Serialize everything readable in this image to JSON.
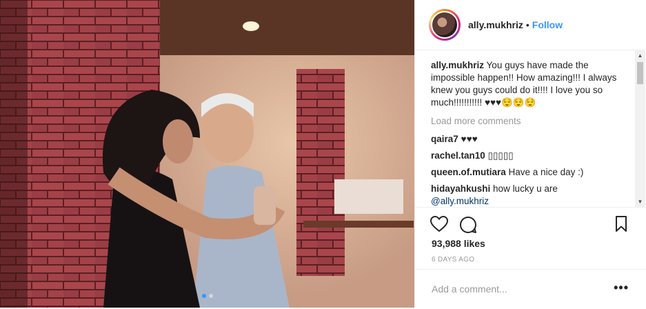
{
  "post": {
    "username": "ally.mukhriz",
    "separator": "•",
    "follow_label": "Follow",
    "caption_user": "ally.mukhriz",
    "caption_text": "You guys have made the impossible happen!! How amazing!!! I always knew you guys could do it!!!! I love you so much!!!!!!!!!!! ♥♥♥😌😌😌",
    "load_more": "Load more comments",
    "comments": [
      {
        "user": "qaira7",
        "text": "♥♥♥"
      },
      {
        "user": "rachel.tan10",
        "text": "▯▯▯▯▯"
      },
      {
        "user": "queen.of.mutiara",
        "text": "Have a nice day :)"
      },
      {
        "user": "hidayahkushi",
        "text": "how lucky u are"
      }
    ],
    "last_mention": "@ally.mukhriz",
    "likes": "93,988 likes",
    "age": "6 DAYS AGO",
    "add_comment_placeholder": "Add a comment...",
    "more_options": "•••"
  },
  "icons": {
    "like": "heart-icon",
    "comment": "comment-bubble-icon",
    "save": "bookmark-icon"
  },
  "colors": {
    "accent": "#3897f0",
    "text": "#262626",
    "muted": "#999999"
  }
}
